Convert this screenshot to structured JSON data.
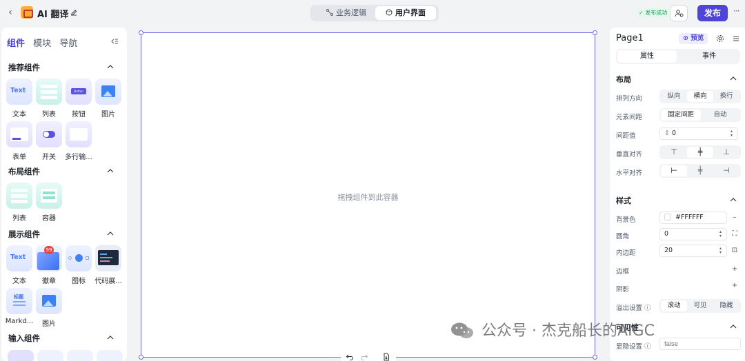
{
  "header": {
    "app_title": "AI 翻译",
    "mode_tabs": [
      {
        "label": "业务逻辑",
        "active": false
      },
      {
        "label": "用户界面",
        "active": true
      }
    ],
    "save_status": "发布成功",
    "publish_label": "发布",
    "more": "···"
  },
  "left_panel": {
    "tabs": [
      {
        "label": "组件",
        "active": true
      },
      {
        "label": "模块",
        "active": false
      },
      {
        "label": "导航",
        "active": false
      }
    ],
    "sections": [
      {
        "title": "推荐组件",
        "items": [
          "文本",
          "列表",
          "按钮",
          "图片",
          "表单",
          "开关",
          "多行输..."
        ]
      },
      {
        "title": "布局组件",
        "items": [
          "列表",
          "容器"
        ]
      },
      {
        "title": "展示组件",
        "items": [
          "文本",
          "徽章",
          "图标",
          "代码展...",
          "Markd...",
          "图片"
        ]
      },
      {
        "title": "输入组件",
        "items": []
      }
    ],
    "tile_text": {
      "text": "Text",
      "button": "Button",
      "badge_count": "99",
      "markdown": "标题"
    }
  },
  "canvas": {
    "drop_hint": "拖拽组件到此容器"
  },
  "right_panel": {
    "page_name": "Page1",
    "preview_label": "预览",
    "tabs": [
      {
        "label": "属性",
        "active": true
      },
      {
        "label": "事件",
        "active": false
      }
    ],
    "layout": {
      "title": "布局",
      "direction_label": "排列方向",
      "direction_options": [
        "纵向",
        "横向",
        "换行"
      ],
      "direction_selected": "横向",
      "spacing_label": "元素间距",
      "spacing_options": [
        "固定间距",
        "自动"
      ],
      "spacing_selected": "固定间距",
      "gap_label": "间距值",
      "gap_value": "0",
      "valign_label": "垂直对齐",
      "halign_label": "水平对齐"
    },
    "style": {
      "title": "样式",
      "bg_label": "背景色",
      "bg_value": "#FFFFFF",
      "radius_label": "圆角",
      "radius_value": "0",
      "padding_label": "内边距",
      "padding_value": "20",
      "border_label": "边框",
      "shadow_label": "阴影",
      "overflow_label": "溢出设置",
      "overflow_options": [
        "滚动",
        "可见",
        "隐藏"
      ],
      "overflow_selected": "滚动"
    },
    "visibility": {
      "title": "可见性",
      "show_label": "显隐设置",
      "show_placeholder": "false"
    }
  },
  "watermark": "公众号 · 杰克船长的AIGC",
  "colors": {
    "accent": "#4e45d6",
    "canvas_border": "#6f67e6",
    "success": "#23a55a"
  }
}
